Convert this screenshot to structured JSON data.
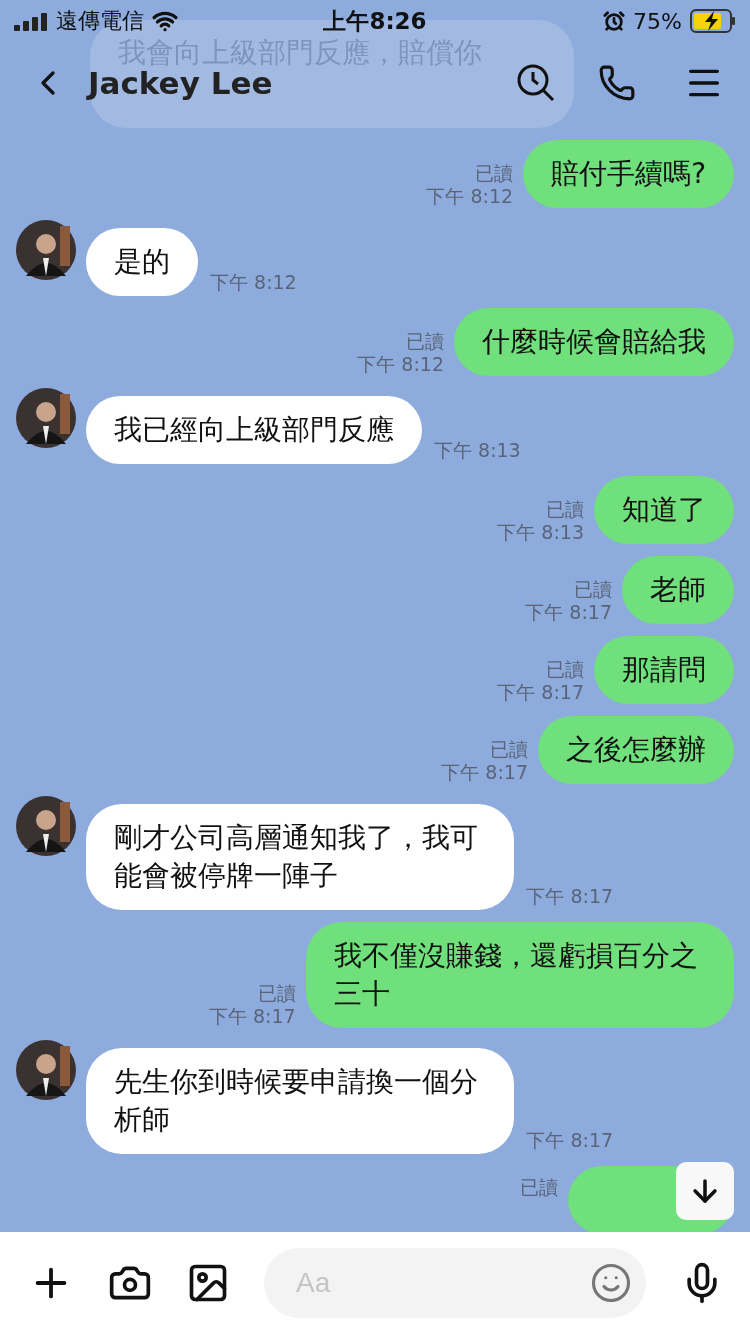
{
  "status_bar": {
    "carrier": "遠傳電信",
    "time": "上午8:26",
    "battery": "75%"
  },
  "header": {
    "title": "Jackey Lee"
  },
  "messages": [
    {
      "kind": "ghost",
      "text": "我會向上級部門反應，賠償你"
    },
    {
      "kind": "out",
      "text": "賠付手續嗎?",
      "read": "已讀",
      "time": "下午 8:12"
    },
    {
      "kind": "in",
      "text": "是的",
      "time": "下午 8:12"
    },
    {
      "kind": "out",
      "text": "什麼時候會賠給我",
      "read": "已讀",
      "time": "下午 8:12"
    },
    {
      "kind": "in",
      "text": "我已經向上級部門反應",
      "time": "下午 8:13"
    },
    {
      "kind": "out",
      "text": "知道了",
      "read": "已讀",
      "time": "下午 8:13"
    },
    {
      "kind": "out",
      "text": "老師",
      "read": "已讀",
      "time": "下午 8:17"
    },
    {
      "kind": "out",
      "text": "那請問",
      "read": "已讀",
      "time": "下午 8:17"
    },
    {
      "kind": "out",
      "text": "之後怎麼辦",
      "read": "已讀",
      "time": "下午 8:17"
    },
    {
      "kind": "in",
      "text": "剛才公司高層通知我了，我可能會被停牌一陣子",
      "time": "下午 8:17"
    },
    {
      "kind": "out",
      "text": "我不僅沒賺錢，還虧損百分之三十",
      "read": "已讀",
      "time": "下午 8:17"
    },
    {
      "kind": "in",
      "text": "先生你到時候要申請換一個分析師",
      "time": "下午 8:17"
    },
    {
      "kind": "out",
      "read": "已讀"
    }
  ],
  "input": {
    "placeholder": "Aa"
  }
}
